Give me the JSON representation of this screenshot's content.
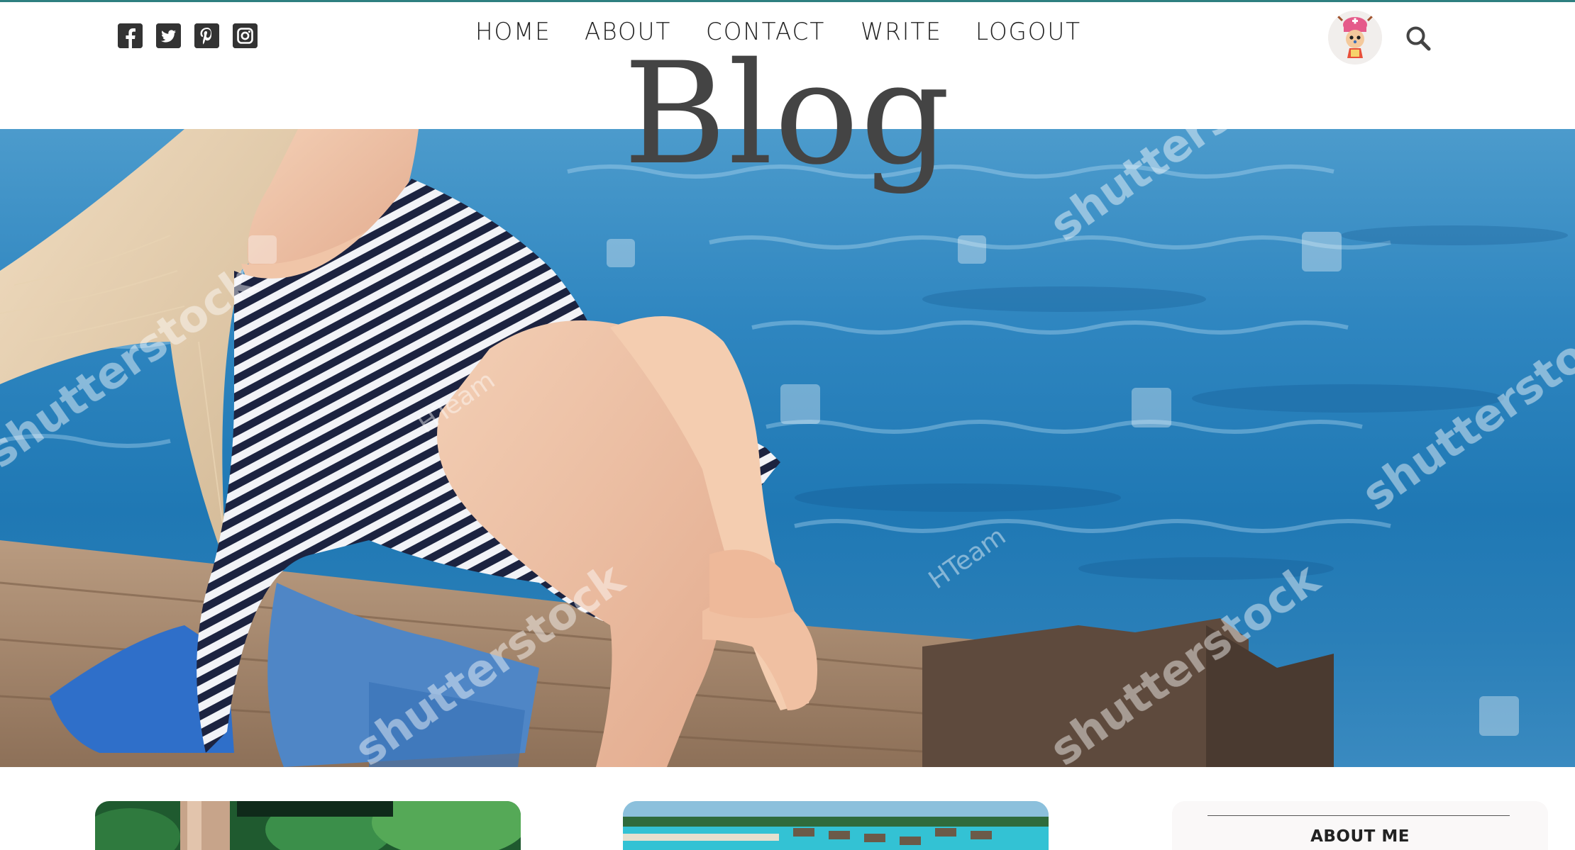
{
  "header": {
    "social_icons": [
      "facebook-square-icon",
      "twitter-square-icon",
      "pinterest-square-icon",
      "instagram-icon"
    ],
    "nav": [
      "HOME",
      "ABOUT",
      "CONTACT",
      "WRITE",
      "LOGOUT"
    ],
    "avatar": "chopper-avatar",
    "search_icon": "search-icon"
  },
  "hero": {
    "title": "Blog",
    "watermarks": [
      "shutterstock",
      "shutterstock",
      "shutterstock",
      "shutterstock",
      "shutterstock",
      "HTeam",
      "HTeam"
    ]
  },
  "posts": [
    {
      "image": "tropical-garden-image"
    },
    {
      "image": "overwater-bungalows-image"
    }
  ],
  "sidebar": {
    "title": "ABOUT ME"
  },
  "colors": {
    "accent_rule": "#2e7f80",
    "title": "#444444",
    "nav_text": "#222222",
    "sea": "#2f86c0"
  }
}
